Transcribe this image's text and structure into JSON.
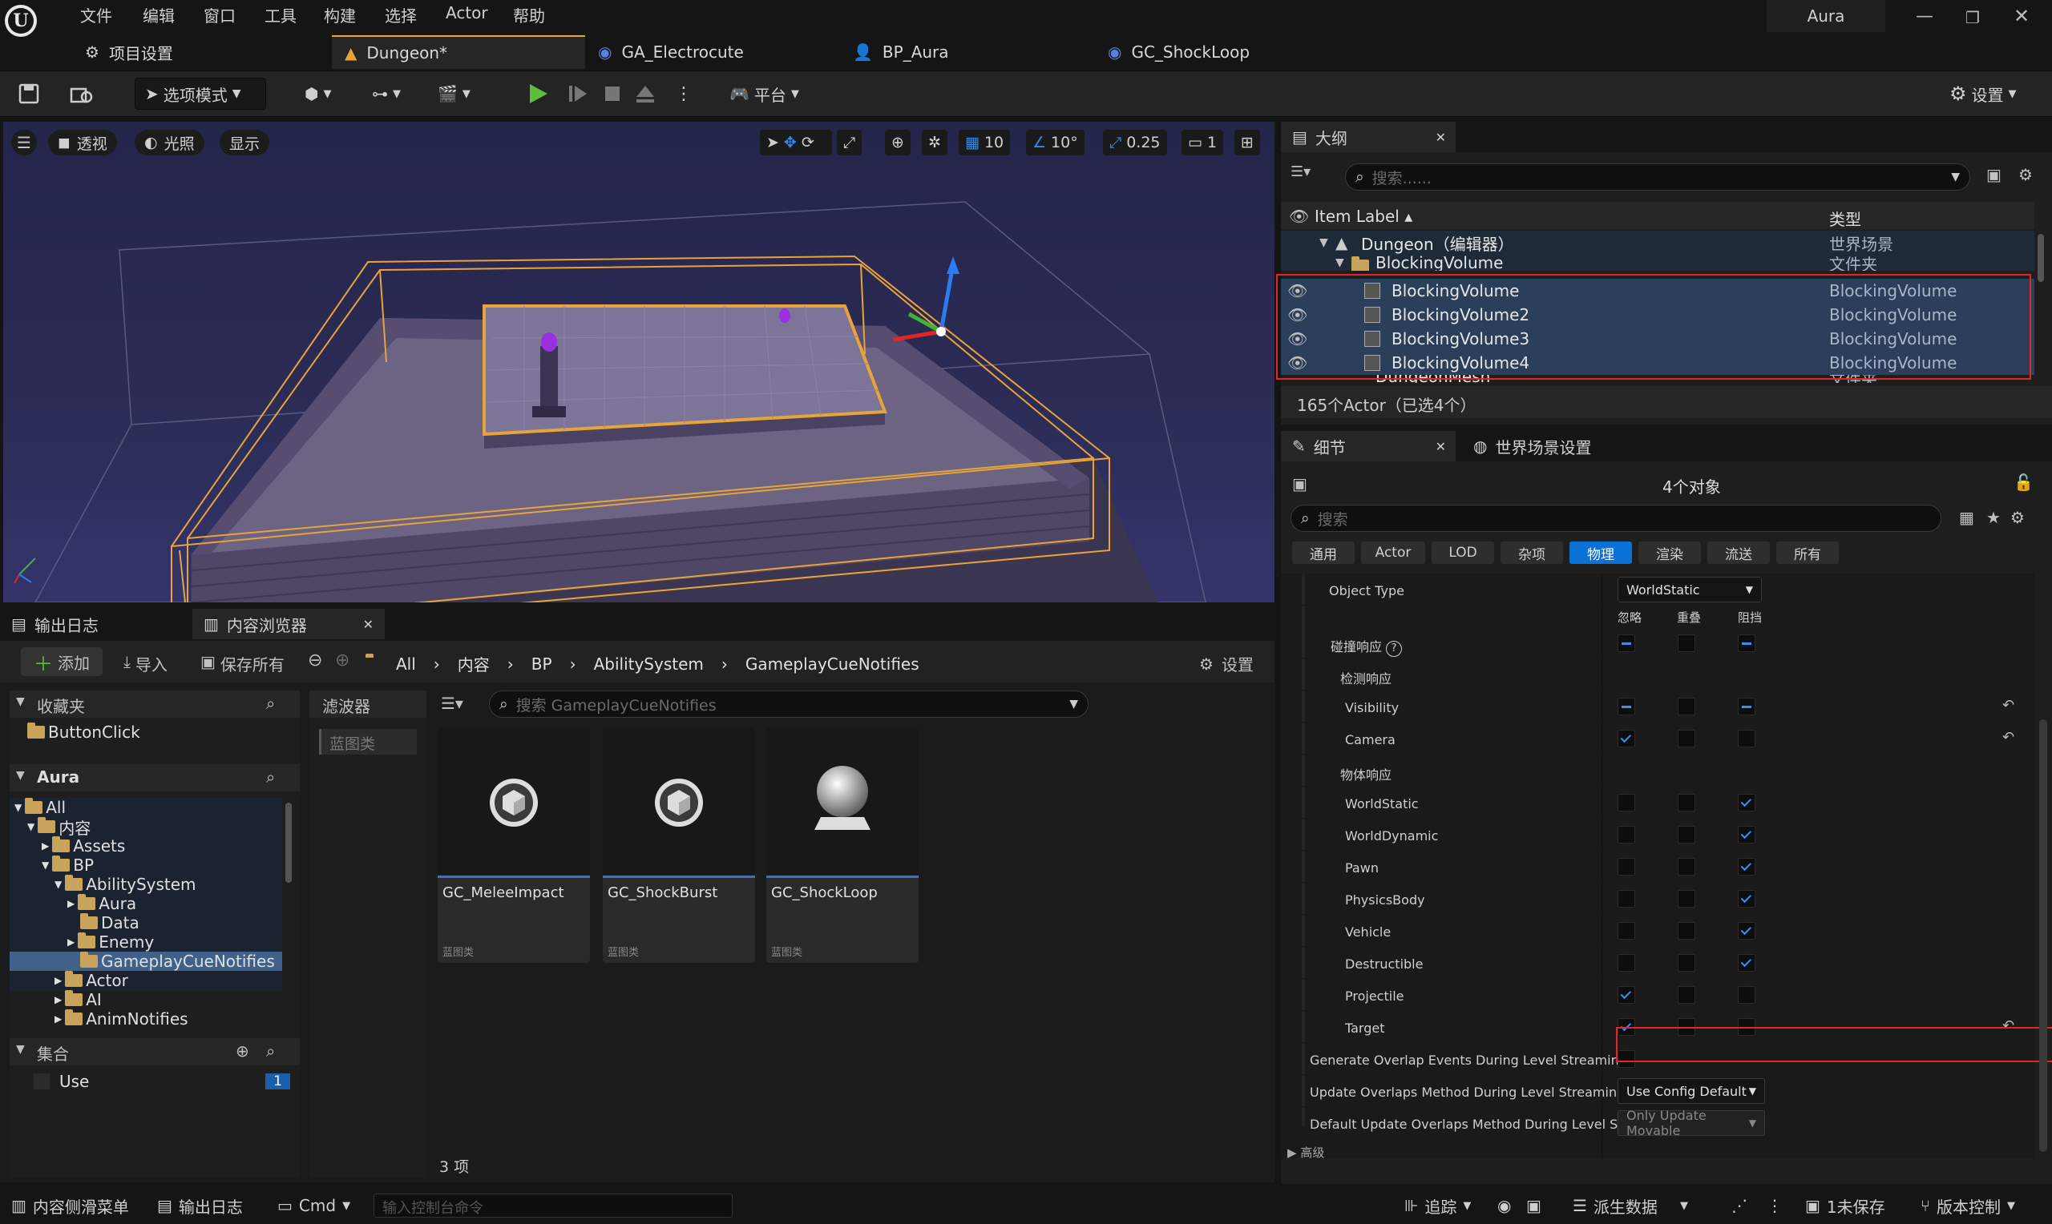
{
  "menu": [
    "文件",
    "编辑",
    "窗口",
    "工具",
    "构建",
    "选择",
    "Actor",
    "帮助"
  ],
  "user": "Aura",
  "tabs": [
    {
      "label": "项目设置",
      "icon": "gear-icon"
    },
    {
      "label": "Dungeon*",
      "icon": "level-icon"
    },
    {
      "label": "GA_Electrocute",
      "icon": "blueprint-icon"
    },
    {
      "label": "BP_Aura",
      "icon": "character-icon"
    },
    {
      "label": "GC_ShockLoop",
      "icon": "blueprint-icon"
    }
  ],
  "toolbar": {
    "mode": "选项模式",
    "platform": "平台",
    "settings": "设置"
  },
  "viewport": {
    "perspective": "透视",
    "lit": "光照",
    "show": "显示",
    "grid": "10",
    "angle": "10°",
    "scale": "0.25",
    "camera_speed": "1"
  },
  "outliner": {
    "title": "大纲",
    "search_placeholder": "搜索......",
    "col_label": "Item Label",
    "col_type": "类型",
    "rows": [
      {
        "label": "Dungeon（编辑器）",
        "type": "世界场景"
      },
      {
        "label": "BlockingVolume",
        "type": "文件夹"
      },
      {
        "label": "BlockingVolume",
        "type": "BlockingVolume"
      },
      {
        "label": "BlockingVolume2",
        "type": "BlockingVolume"
      },
      {
        "label": "BlockingVolume3",
        "type": "BlockingVolume"
      },
      {
        "label": "BlockingVolume4",
        "type": "BlockingVolume"
      },
      {
        "label": "DungeonMesh",
        "type": "文件夹"
      }
    ],
    "status": "165个Actor（已选4个）"
  },
  "details": {
    "tab": "细节",
    "tab2": "世界场景设置",
    "object_count": "4个对象",
    "search_placeholder": "搜索",
    "filters": [
      "通用",
      "Actor",
      "LOD",
      "杂项",
      "物理",
      "渲染",
      "流送",
      "所有"
    ],
    "active_filter": "物理",
    "object_type_label": "Object Type",
    "object_type_value": "WorldStatic",
    "col_ignore": "忽略",
    "col_overlap": "重叠",
    "col_block": "阻挡",
    "collision_response": "碰撞响应",
    "trace_response": "检测响应",
    "object_response": "物体响应",
    "responses": [
      {
        "name": "Visibility",
        "state": "ignore-block"
      },
      {
        "name": "Camera",
        "state": "ignore"
      },
      {
        "name": "WorldStatic",
        "state": "block"
      },
      {
        "name": "WorldDynamic",
        "state": "block"
      },
      {
        "name": "Pawn",
        "state": "block"
      },
      {
        "name": "PhysicsBody",
        "state": "block"
      },
      {
        "name": "Vehicle",
        "state": "block"
      },
      {
        "name": "Destructible",
        "state": "block"
      },
      {
        "name": "Projectile",
        "state": "ignore"
      },
      {
        "name": "Target",
        "state": "ignore"
      }
    ],
    "gen_overlap": "Generate Overlap Events During Level Streaming",
    "update_overlap": "Update Overlaps Method During Level Streaming",
    "update_overlap_value": "Use Config Default",
    "default_update": "Default Update Overlaps Method During Level Str...",
    "default_update_value": "Only Update Movable",
    "advanced": "高级"
  },
  "bottom_tabs": {
    "output": "输出日志",
    "content": "内容浏览器"
  },
  "content": {
    "add": "添加",
    "import": "导入",
    "save_all": "保存所有",
    "path": [
      "All",
      "内容",
      "BP",
      "AbilitySystem",
      "GameplayCueNotifies"
    ],
    "settings": "设置",
    "favorites": "收藏夹",
    "fav_item": "ButtonClick",
    "project": "Aura",
    "tree": [
      "All",
      "内容",
      "Assets",
      "BP",
      "AbilitySystem",
      "Aura",
      "Data",
      "Enemy",
      "GameplayCueNotifies",
      "Actor",
      "AI",
      "AnimNotifies"
    ],
    "collections": "集合",
    "collection_item": "Use",
    "collection_count": "1",
    "filters": "滤波器",
    "filter_chip": "蓝图类",
    "search_placeholder": "搜索 GameplayCueNotifies",
    "assets": [
      {
        "name": "GC_MeleeImpact",
        "type": "蓝图类"
      },
      {
        "name": "GC_ShockBurst",
        "type": "蓝图类"
      },
      {
        "name": "GC_ShockLoop",
        "type": "蓝图类"
      }
    ],
    "count": "3 项"
  },
  "status": {
    "drawer": "内容侧滑菜单",
    "output": "输出日志",
    "cmd": "Cmd",
    "console_placeholder": "输入控制台命令",
    "trace": "追踪",
    "derived": "派生数据",
    "unsaved": "1未保存",
    "source": "版本控制"
  },
  "colors": {
    "accent": "#0a72d6",
    "selection": "#e8a33b",
    "warning": "#e02626"
  }
}
